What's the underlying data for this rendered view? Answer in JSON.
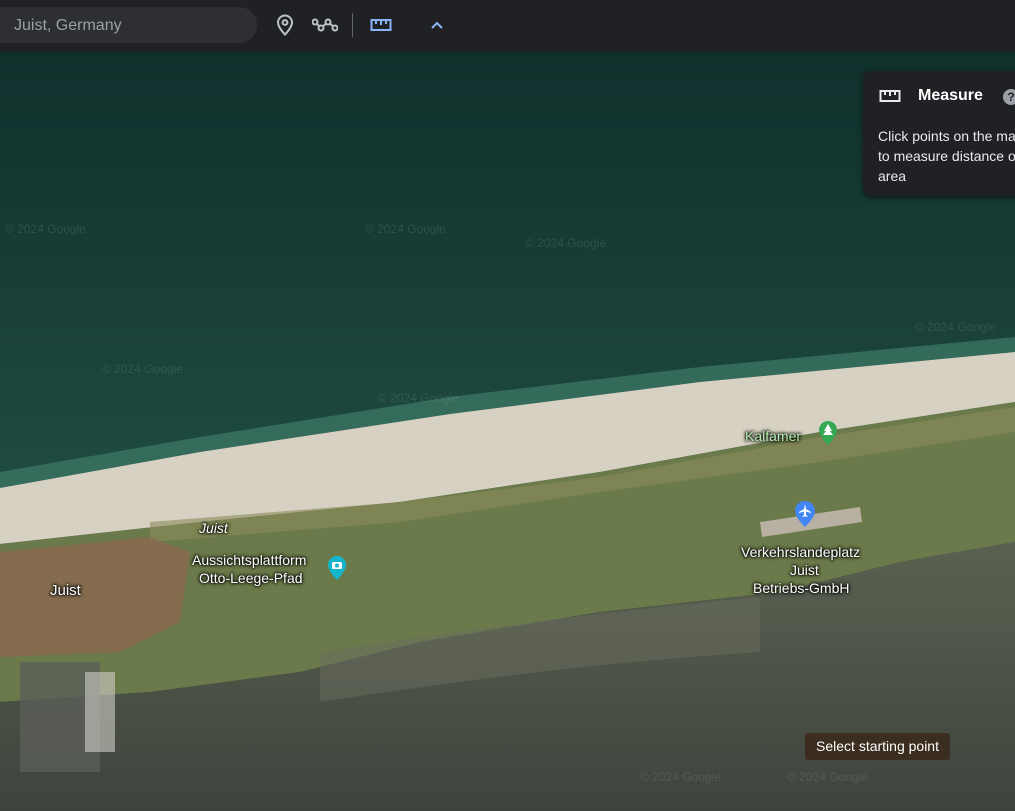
{
  "search": {
    "value": "",
    "placeholder": "Juist, Germany"
  },
  "toolbar": {
    "icons": [
      "location-pin-icon",
      "route-icon",
      "ruler-icon",
      "chevron-up-icon"
    ],
    "accent": "#8ab4f8"
  },
  "measure": {
    "title": "Measure",
    "help": "?",
    "text": "Click points on the map to measure distance or area"
  },
  "tooltip": "Select starting point",
  "map": {
    "labels": [
      {
        "text": "Juist"
      },
      {
        "text": "Aussichtsplattform"
      },
      {
        "text": "Otto-Leege-Pfad"
      },
      {
        "text": "Juist"
      },
      {
        "text": "Kalfamer"
      },
      {
        "text": "Verkehrslandeplatz"
      },
      {
        "text": "Juist"
      },
      {
        "text": "Betriebs-GmbH"
      }
    ],
    "watermark": "© 2024 Google",
    "pins": [
      "camera-pin-icon",
      "park-pin-icon",
      "airport-pin-icon"
    ],
    "colors": {
      "sea": "#1d4a40",
      "beach": "#d7d1c3",
      "land": "#6b7a4a",
      "mudflat": "#4c524a"
    }
  }
}
